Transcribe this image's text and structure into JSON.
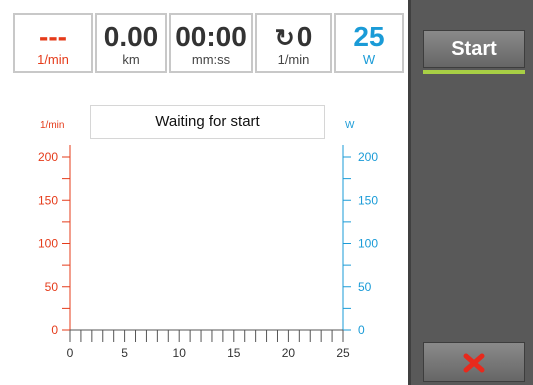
{
  "stats": [
    {
      "value": "---",
      "unit": "1/min",
      "color": "red"
    },
    {
      "value": "0.00",
      "unit": "km",
      "color": "dark"
    },
    {
      "value": "00:00",
      "unit": "mm:ss",
      "color": "dark"
    },
    {
      "value": "0",
      "unit": "1/min",
      "color": "dark",
      "icon": "rotate-icon"
    },
    {
      "value": "25",
      "unit": "W",
      "color": "blue"
    }
  ],
  "status": "Waiting for start",
  "buttons": {
    "start_label": "Start",
    "cancel_icon": "close-icon"
  },
  "colors": {
    "left_axis": "#e53b1a",
    "right_axis": "#1a9bd7",
    "accent": "#a8cf45"
  },
  "chart_data": {
    "type": "line",
    "left_axis": {
      "label": "1/min",
      "range": [
        0,
        200
      ],
      "ticks": [
        "0",
        "50",
        "100",
        "150",
        "200"
      ]
    },
    "right_axis": {
      "label": "W",
      "range": [
        0,
        200
      ],
      "ticks": [
        "0",
        "50",
        "100",
        "150",
        "200"
      ]
    },
    "x_axis": {
      "range": [
        0,
        25
      ],
      "ticks": [
        "0",
        "5",
        "10",
        "15",
        "20",
        "25"
      ]
    },
    "series": []
  }
}
